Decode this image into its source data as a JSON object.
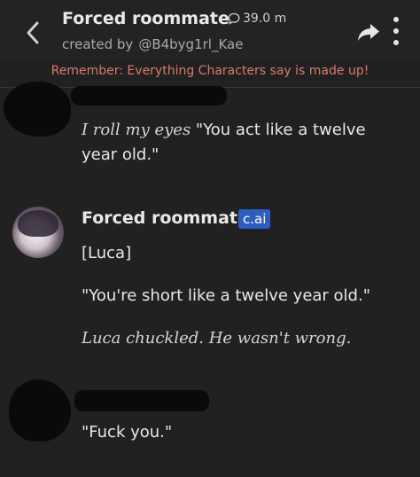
{
  "header": {
    "title": "Forced roommate",
    "interaction_count": "39.0 m",
    "creator_prefix": "created by",
    "creator_handle": "@B4byg1rl_Kae"
  },
  "disclaimer": "Remember: Everything Characters say is made up!",
  "messages": [
    {
      "sender": "",
      "lines": [
        {
          "text": "I roll my eyes",
          "style": "italic"
        },
        {
          "text": " \"You act like a twelve year old.\"",
          "style": "normal"
        }
      ]
    },
    {
      "sender": "Forced roommate",
      "badge": "c.ai",
      "paragraphs": [
        {
          "text": "[Luca]",
          "style": "normal"
        },
        {
          "text": "\"You're short like a twelve year old.\"",
          "style": "normal"
        },
        {
          "text": "Luca chuckled. He wasn't wrong.",
          "style": "italic"
        }
      ]
    },
    {
      "sender": "",
      "paragraphs": [
        {
          "text": "\"Fuck you.\"",
          "style": "normal"
        }
      ]
    }
  ],
  "colors": {
    "background": "#212121",
    "disclaimer": "#d77a6d",
    "badge": "#2f5dbf"
  },
  "icons": [
    "back-arrow-icon",
    "chat-bubble-icon",
    "share-icon",
    "more-vertical-icon"
  ]
}
